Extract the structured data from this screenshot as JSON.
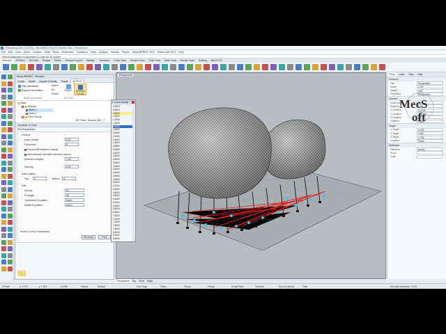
{
  "window": {
    "title": "RhinoBody.3dm (113 KB) - MecsSoft 3 Print Fix Header.3dm - Rhinoceros",
    "menu": [
      "File",
      "Edit",
      "View",
      "Curve",
      "Surface",
      "Solid",
      "Mesh",
      "Dimension",
      "Transform",
      "Tools",
      "Analyze",
      "Render",
      "Panels",
      "MecsoftPRINT 2017",
      "RhinoCAM 2017",
      "Help"
    ]
  },
  "command_prompt": "Select parameters to generate G-Code for 3D printer",
  "toolbar_tabs": [
    "Standard",
    "CPlanes",
    "Set View",
    "Display",
    "Select",
    "Viewport Layout",
    "Visibility",
    "Transform",
    "Curve Tools",
    "Surface Tools",
    "Solid Tools",
    "Mesh Tools",
    "Render Tools",
    "Drafting",
    "New in V5"
  ],
  "panel": {
    "title": "MecsoftPRINT - Browser",
    "tabs": [
      "Create",
      "Model",
      "Inspect & Modify",
      "Repair",
      "3D Print"
    ],
    "ribbon": {
      "left_items": [
        "Part Orientation",
        "Support Generation"
      ],
      "right_items": [
        "Select",
        "Fit",
        "Check"
      ],
      "export_label": "Export",
      "generate_label": "Generate G-Code",
      "group_build": "Build preparation",
      "group_print": "3D Print"
    },
    "tree": {
      "root": "Data",
      "meshes": "Meshes",
      "items": [
        "Mesh 1",
        "Mesh 2"
      ],
      "clouds": "Point Clouds"
    },
    "gcode_title": "Generate G-Code",
    "gcode_tab": "Print Parameters",
    "printer_label": "3D Printer: Dropbot (#8)...2",
    "form": {
      "general": "General",
      "layer_height_label": "Layer Height",
      "layer_height": "0.20",
      "perimeters_label": "Perimeters",
      "perimeters": "3",
      "extract_label": "Extract infill between Islands",
      "auto_calc_label": "Automatically calculate extrusion volume",
      "material_label": "Material multiplier",
      "material": "1.00",
      "spacing_label": "Spacing",
      "spacing": "0.20",
      "solid_layers": "Solid Layers",
      "top_label": "Top",
      "top": "3",
      "bottom_label": "Bottom",
      "bottom": "3",
      "infill": "Infill",
      "density_label": "Density",
      "density": "40",
      "fill_angle_label": "Fill angle",
      "fill_angle": "45",
      "solid_pattern_label": "Top/bottom fill pattern",
      "solid_pattern": "Hatch",
      "middle_pattern_label": "Middle fill pattern",
      "middle_pattern": "Hatch",
      "control_label": "Printer Control Parameters",
      "generate_btn": "Generate",
      "print_btn": "Print"
    }
  },
  "layer_dialog": {
    "title": "Z Level Display",
    "values": [
      "0.4000",
      "0.6000",
      "0.8000",
      "1.0000",
      "1.2000",
      "1.4000",
      "1.6000",
      "1.8000",
      "2.0000",
      "2.2000",
      "2.4000",
      "2.6000",
      "2.8000",
      "3.0000",
      "3.2000",
      "3.4000",
      "3.6000",
      "3.8000",
      "4.0000",
      "4.2000",
      "4.4000",
      "4.6000",
      "4.8000",
      "5.0000",
      "5.2000",
      "5.4000",
      "5.6000",
      "5.8000",
      "6.0000",
      "6.2000",
      "6.4000",
      "6.6000",
      "6.8000",
      "7.0000",
      "7.2000",
      "7.4000",
      "7.6000",
      "7.8000",
      "8.0000",
      "8.2000",
      "8.4000"
    ],
    "selected_index": 6,
    "highlight_index": 2
  },
  "viewport": {
    "label": "Perspective",
    "tabs": [
      "Perspective",
      "Top",
      "Front",
      "Right"
    ]
  },
  "properties": {
    "tabs": [
      "Prop",
      "Layer",
      "Disp",
      "Help"
    ],
    "viewport_section": "Viewport",
    "rows1": [
      {
        "k": "Title",
        "v": "Perspective"
      },
      {
        "k": "Width",
        "v": "1730"
      },
      {
        "k": "Height",
        "v": "1027"
      },
      {
        "k": "Projection",
        "v": "Perspective"
      }
    ],
    "camera_section": "Camera",
    "rows2": [
      {
        "k": "Lens Length",
        "v": "50.0"
      },
      {
        "k": "Rotation",
        "v": "0.0"
      },
      {
        "k": "X Location",
        "v": "13.878"
      },
      {
        "k": "Y Location",
        "v": "-16.748"
      },
      {
        "k": "Z Location",
        "v": "8.272"
      },
      {
        "k": "Location",
        "v": "Place..."
      }
    ],
    "target_section": "Target",
    "rows3": [
      {
        "k": "X Target",
        "v": "3.093"
      },
      {
        "k": "Y Target",
        "v": "2.867"
      },
      {
        "k": "Z Target",
        "v": "2.780"
      },
      {
        "k": "Location",
        "v": "Place..."
      }
    ],
    "wallpaper_section": "Wallpaper",
    "rows4": [
      {
        "k": "Filename",
        "v": "(none)"
      },
      {
        "k": "Show",
        "v": ""
      },
      {
        "k": "Gray",
        "v": ""
      }
    ]
  },
  "status": {
    "cplane": "CPlane",
    "x": "x -0.071",
    "y": "y 7.234",
    "z": "z 0.000",
    "units": "Inches",
    "layer": "Default",
    "toggles": [
      "Grid Snap",
      "Ortho",
      "Planar",
      "Osnap",
      "SmartTrack",
      "Gumball",
      "Record History",
      "Filter"
    ],
    "memory": "Absolute tolerance: 0.001"
  },
  "logo_text": "MecSoft",
  "colors": {
    "accent": "#2d6cc0",
    "viewport_bg": "#b9bcc0",
    "toolpath": "#e0201e",
    "supports": "#35c6e8"
  }
}
